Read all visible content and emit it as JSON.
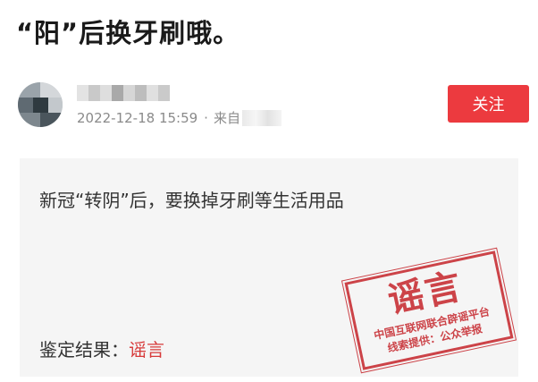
{
  "article": {
    "title": "“阳”后换牙刷哦。"
  },
  "author": {
    "date": "2022-12-18 15:59",
    "separator": "·",
    "source_prefix": "来自",
    "follow_label": "关注"
  },
  "card": {
    "claim": "新冠“转阴”后，要换掉牙刷等生活用品",
    "verdict_label": "鉴定结果：",
    "verdict_value": "谣言"
  },
  "stamp": {
    "main": "谣言",
    "line1": "中国互联网联合辟谣平台",
    "line2": "线索提供：公众举报"
  },
  "colors": {
    "accent": "#ec3a3f",
    "stamp": "#c9343a",
    "verdict": "#d73a3a",
    "card_bg": "#f5f5f5"
  }
}
